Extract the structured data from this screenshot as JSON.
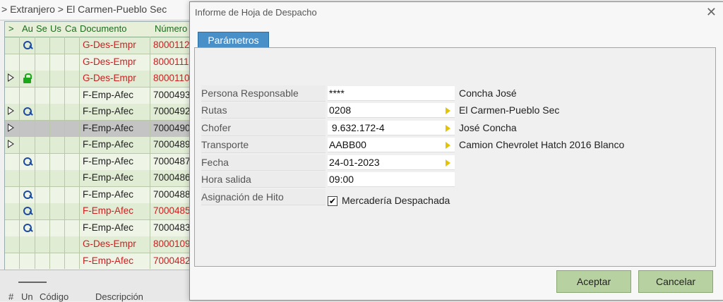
{
  "background": {
    "breadcrumb": "> Extranjero > El Carmen-Pueblo Sec",
    "grid": {
      "headers": [
        ">",
        "Au",
        "Se",
        "Us",
        "Ca",
        "Documento",
        "Número"
      ],
      "rows": [
        {
          "icon": "key",
          "doc": "G-Des-Empr",
          "num": "8000112",
          "color": "red"
        },
        {
          "icon": "",
          "doc": "G-Des-Empr",
          "num": "8000111",
          "color": "red"
        },
        {
          "icon": "lock",
          "marker": true,
          "doc": "G-Des-Empr",
          "num": "8000110",
          "color": "red"
        },
        {
          "icon": "",
          "doc": "F-Emp-Afec",
          "num": "7000493",
          "color": "black"
        },
        {
          "icon": "key",
          "marker": true,
          "doc": "F-Emp-Afec",
          "num": "7000492",
          "color": "black"
        },
        {
          "icon": "",
          "marker": true,
          "selected": true,
          "doc": "F-Emp-Afec",
          "num": "7000490",
          "color": "black"
        },
        {
          "icon": "",
          "marker": true,
          "doc": "F-Emp-Afec",
          "num": "7000489",
          "color": "black"
        },
        {
          "icon": "key",
          "doc": "F-Emp-Afec",
          "num": "7000487",
          "color": "black"
        },
        {
          "icon": "",
          "doc": "F-Emp-Afec",
          "num": "7000486",
          "color": "black"
        },
        {
          "icon": "key",
          "doc": "F-Emp-Afec",
          "num": "7000488",
          "color": "black"
        },
        {
          "icon": "key",
          "doc": "F-Emp-Afec",
          "num": "7000485",
          "color": "red"
        },
        {
          "icon": "key",
          "doc": "F-Emp-Afec",
          "num": "7000483",
          "color": "black"
        },
        {
          "icon": "",
          "doc": "G-Des-Empr",
          "num": "8000109",
          "color": "red"
        },
        {
          "icon": "",
          "doc": "F-Emp-Afec",
          "num": "7000482",
          "color": "red"
        }
      ]
    },
    "bottom_headers": [
      "#",
      "Un",
      "Código",
      "Descripción"
    ]
  },
  "dialog": {
    "title": "Informe de Hoja de Despacho",
    "close_label": "✕",
    "tab_label": "Parámetros",
    "fields": [
      {
        "label": "Persona Responsable",
        "value": "****",
        "has_lookup": false,
        "info": "Concha José"
      },
      {
        "label": "Rutas",
        "value": "0208",
        "has_lookup": true,
        "info": "El Carmen-Pueblo Sec"
      },
      {
        "label": "Chofer",
        "value": " 9.632.172-4",
        "has_lookup": true,
        "info": "José Concha"
      },
      {
        "label": "Transporte",
        "value": "AABB00",
        "has_lookup": true,
        "info": "Camion Chevrolet Hatch 2016 Blanco"
      },
      {
        "label": "Fecha",
        "value": "24-01-2023",
        "has_lookup": true,
        "info": ""
      },
      {
        "label": "Hora salida",
        "value": "09:00",
        "has_lookup": false,
        "info": ""
      }
    ],
    "milestone": {
      "label": "Asignación de Hito",
      "checkbox_label": "Mercadería Despachada",
      "checked": true,
      "check_glyph": "✔"
    },
    "buttons": {
      "accept": "Aceptar",
      "cancel": "Cancelar"
    }
  },
  "colors": {
    "tab_blue": "#4a90c8",
    "button_green": "#b7d1a0",
    "red_text": "#cc2020",
    "lookup_arrow": "#e2c400"
  }
}
